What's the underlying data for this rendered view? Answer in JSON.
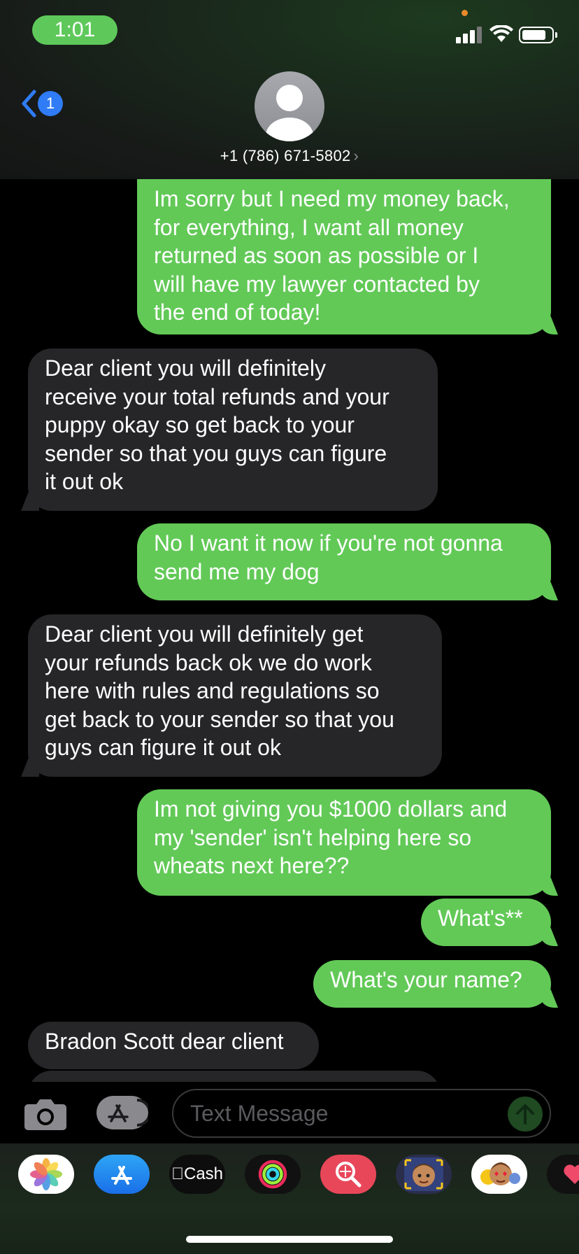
{
  "status_bar": {
    "time": "1:01"
  },
  "header": {
    "back_badge": "1",
    "contact": "+1 (786) 671-5802"
  },
  "messages": [
    {
      "type": "sent",
      "text": "Im sorry but I need my money back,\nfor everything, I want all money\nreturned as soon as possible or I\nwill have my lawyer contacted by\nthe end of today!"
    },
    {
      "type": "received",
      "text": "Dear client you will definitely\nreceive your total refunds and your\npuppy okay so get back to your\nsender so that you guys can figure\nit out ok"
    },
    {
      "type": "sent",
      "text": "No I want it now if you're not gonna\nsend me my dog"
    },
    {
      "type": "received",
      "text": "Dear client you will definitely get\nyour refunds back ok we do work\nhere with rules and regulations so\nget back to your sender so that you\nguys can figure it out ok"
    },
    {
      "type": "sent",
      "text": "Im not giving you $1000 dollars and\nmy 'sender' isn't helping here so\nwheats next here??"
    },
    {
      "type": "sent",
      "text": "What's**"
    },
    {
      "type": "sent",
      "text": "What's your name?"
    },
    {
      "type": "received",
      "text": "Bradon Scott dear client"
    }
  ],
  "input": {
    "placeholder": "Text Message"
  },
  "apps": [
    {
      "name": "photos-app-icon"
    },
    {
      "name": "app-store-icon"
    },
    {
      "name": "apple-cash-icon",
      "label": "Cash"
    },
    {
      "name": "activity-icon"
    },
    {
      "name": "images-search-icon"
    },
    {
      "name": "memoji-icon"
    },
    {
      "name": "memoji-stickers-icon"
    },
    {
      "name": "digital-touch-icon"
    }
  ],
  "colors": {
    "sent": "#62c957",
    "received": "#262628",
    "accent": "#2f7cf6"
  }
}
